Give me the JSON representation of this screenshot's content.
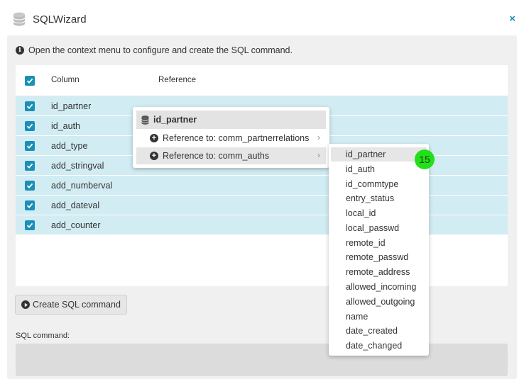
{
  "window": {
    "title": "SQLWizard",
    "close_label": "×"
  },
  "info": {
    "text": "Open the context menu to configure and create the SQL command."
  },
  "table": {
    "headers": {
      "column": "Column",
      "reference": "Reference"
    },
    "rows": [
      {
        "column": "id_partner"
      },
      {
        "column": "id_auth"
      },
      {
        "column": "add_type"
      },
      {
        "column": "add_stringval"
      },
      {
        "column": "add_numberval"
      },
      {
        "column": "add_dateval"
      },
      {
        "column": "add_counter"
      }
    ]
  },
  "actions": {
    "create_label": "Create SQL command"
  },
  "sql": {
    "label": "SQL command:",
    "value": ""
  },
  "context_menu": {
    "header": "id_partner",
    "items": [
      {
        "label": "Reference to: comm_partnerrelations"
      },
      {
        "label": "Reference to: comm_auths"
      }
    ],
    "chevron": "›"
  },
  "submenu": {
    "items": [
      "id_partner",
      "id_auth",
      "id_commtype",
      "entry_status",
      "local_id",
      "local_passwd",
      "remote_id",
      "remote_passwd",
      "remote_address",
      "allowed_incoming",
      "allowed_outgoing",
      "name",
      "date_created",
      "date_changed"
    ]
  },
  "badge": {
    "text": "15"
  },
  "colors": {
    "accent": "#1a8fb8",
    "row_selected": "#d2ecf3",
    "badge": "#22e11a"
  }
}
